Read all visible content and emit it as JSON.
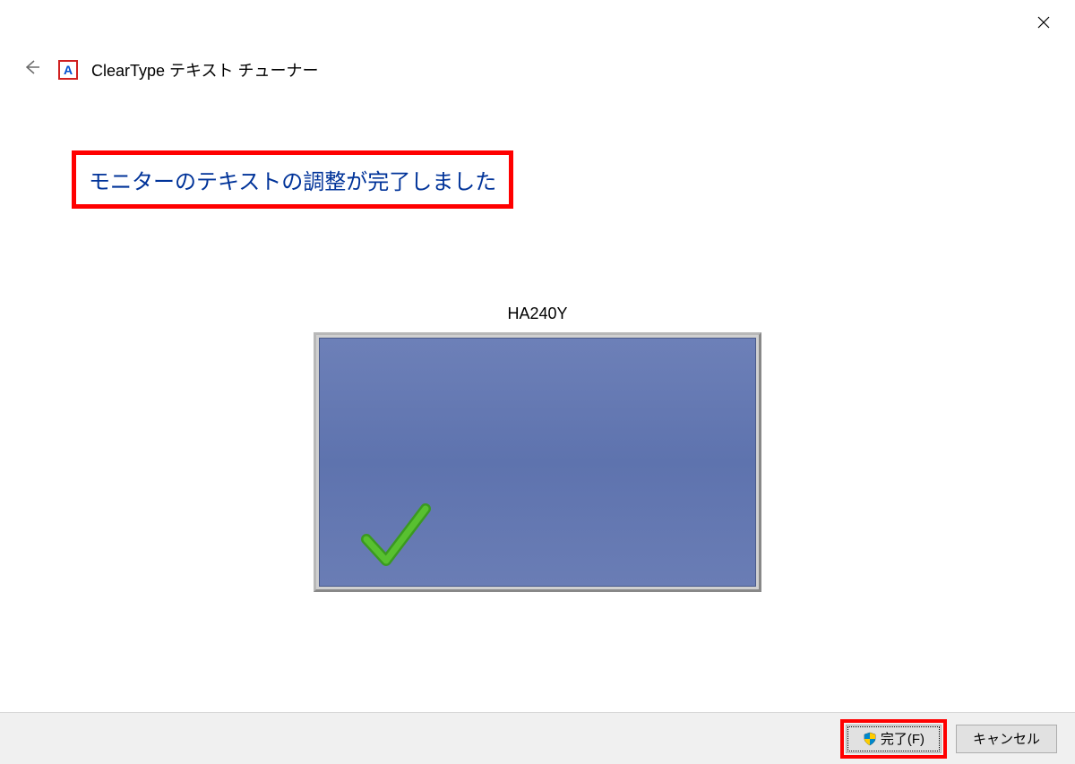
{
  "window": {
    "title": "ClearType テキスト チューナー"
  },
  "content": {
    "completion_message": "モニターのテキストの調整が完了しました",
    "monitor_name": "HA240Y"
  },
  "buttons": {
    "finish": "完了(F)",
    "cancel": "キャンセル"
  }
}
